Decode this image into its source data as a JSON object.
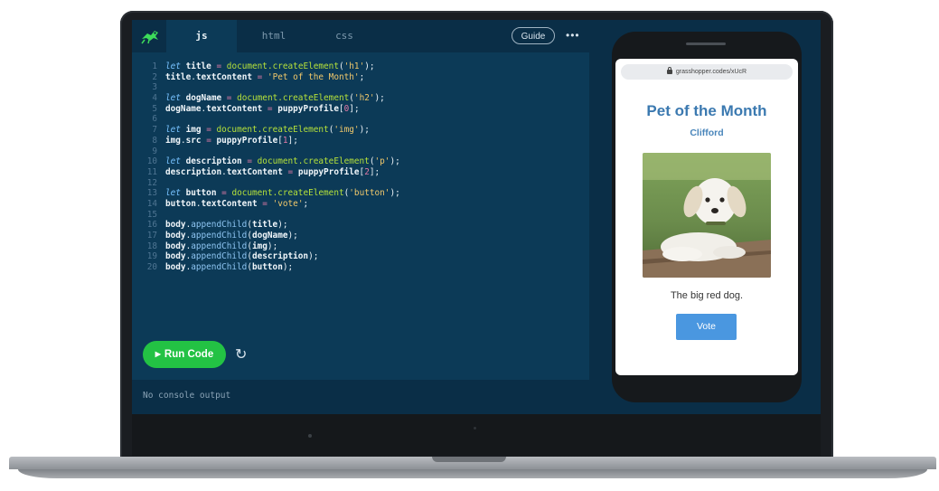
{
  "editor": {
    "tabs": [
      {
        "label": "js",
        "active": true
      },
      {
        "label": "html",
        "active": false
      },
      {
        "label": "css",
        "active": false
      }
    ],
    "guide_label": "Guide",
    "more_label": "•••",
    "run_label": "Run Code",
    "console_text": "No console output",
    "code_lines": [
      "let title = document.createElement('h1');",
      "title.textContent = 'Pet of the Month';",
      "",
      "let dogName = document.createElement('h2');",
      "dogName.textContent = puppyProfile[0];",
      "",
      "let img = document.createElement('img');",
      "img.src = puppyProfile[1];",
      "",
      "let description = document.createElement('p');",
      "description.textContent = puppyProfile[2];",
      "",
      "let button = document.createElement('button');",
      "button.textContent = 'vote';",
      "",
      "body.appendChild(title);",
      "body.appendChild(dogName);",
      "body.appendChild(img);",
      "body.appendChild(description);",
      "body.appendChild(button);"
    ]
  },
  "preview": {
    "url": "grasshopper.codes/xUcR",
    "title": "Pet of the Month",
    "dog_name": "Clifford",
    "description": "The big red dog.",
    "button_label": "Vote",
    "image_icon": "puppy-photo"
  },
  "colors": {
    "run_button": "#23c244",
    "preview_title": "#3b79b0",
    "vote_button": "#4a97e0",
    "editor_bg": "#0c3a57"
  }
}
